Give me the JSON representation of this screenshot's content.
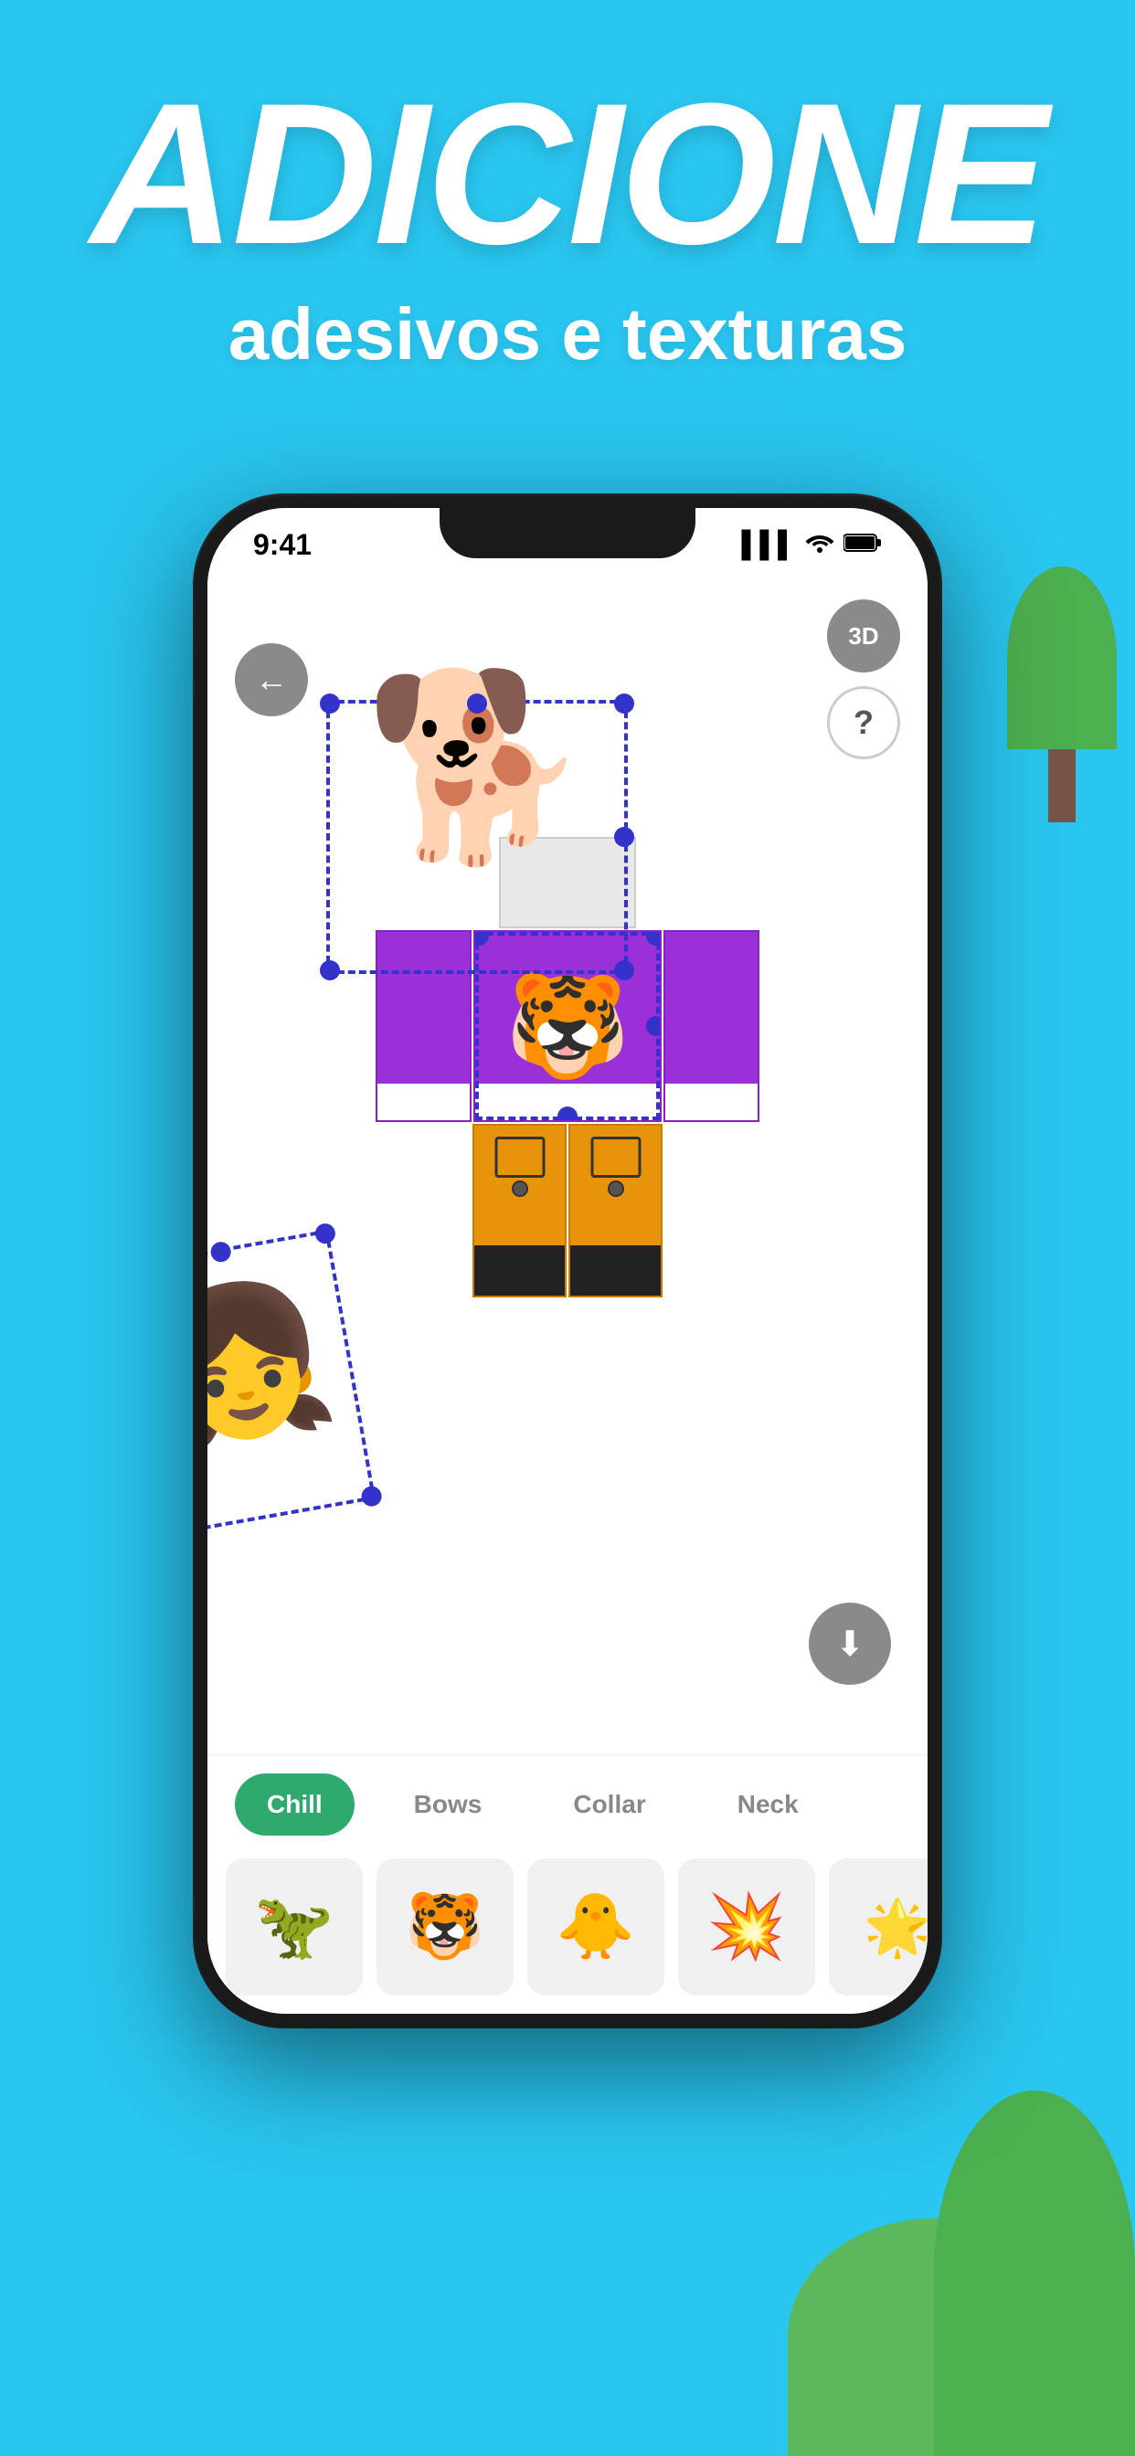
{
  "header": {
    "main_title": "ADICIONE",
    "subtitle": "adesivos e texturas"
  },
  "phone": {
    "status_bar": {
      "time": "9:41",
      "signal_icon": "▌▌▌",
      "wifi_icon": "wifi",
      "battery_icon": "🔋"
    },
    "buttons": {
      "back_label": "←",
      "btn_3d_label": "3D",
      "btn_help_label": "?"
    },
    "tabs": [
      {
        "id": "chill",
        "label": "Chill",
        "active": true
      },
      {
        "id": "bows",
        "label": "Bows",
        "active": false
      },
      {
        "id": "collar",
        "label": "Collar",
        "active": false
      },
      {
        "id": "neck",
        "label": "Neck",
        "active": false
      }
    ],
    "download_icon": "⬇"
  },
  "colors": {
    "background": "#29c6f0",
    "shirt_color": "#9b30d8",
    "pants_color": "#e8940a",
    "tab_active": "#2eaa6e",
    "selection_dashes": "#3333cc",
    "back_btn": "#8a8a8a",
    "download_btn": "#8a8a8a"
  },
  "stickers": [
    {
      "id": "dinosaur",
      "emoji": "🦖"
    },
    {
      "id": "tiger",
      "emoji": "🐯"
    },
    {
      "id": "duck",
      "emoji": "🐥"
    },
    {
      "id": "explosion",
      "emoji": "💥"
    }
  ]
}
